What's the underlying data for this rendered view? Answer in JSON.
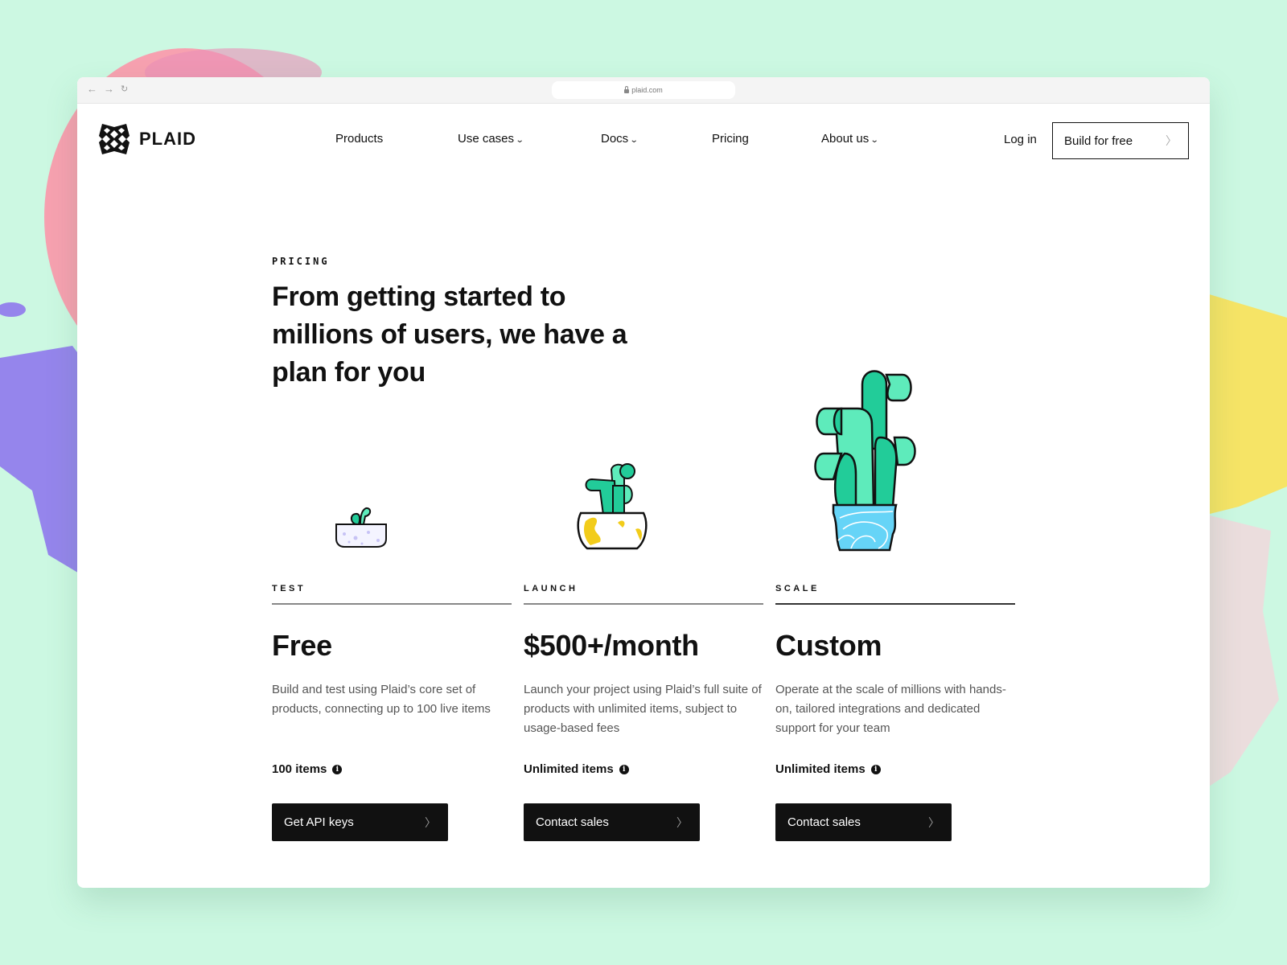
{
  "browser": {
    "url": "plaid.com",
    "back_icon": "←",
    "forward_icon": "→",
    "reload_icon": "↻"
  },
  "header": {
    "logo_text": "PLAID",
    "nav": [
      {
        "label": "Products",
        "has_dropdown": false
      },
      {
        "label": "Use cases",
        "has_dropdown": true
      },
      {
        "label": "Docs",
        "has_dropdown": true
      },
      {
        "label": "Pricing",
        "has_dropdown": false
      },
      {
        "label": "About us",
        "has_dropdown": true
      }
    ],
    "chevron_glyph": "⌄",
    "login_label": "Log in",
    "build_label": "Build for free",
    "arrow_glyph": "〉"
  },
  "hero": {
    "eyebrow": "PRICING",
    "headline": "From getting started to millions of users, we have a plan for you"
  },
  "plans": [
    {
      "tier": "TEST",
      "price": "Free",
      "description": "Build and test using Plaid’s core set of products, connecting up to 100 live items",
      "items": "100 items",
      "cta": "Get API keys"
    },
    {
      "tier": "LAUNCH",
      "price": "$500+/month",
      "description": "Launch your project using Plaid’s full suite of products with unlimited items, subject to usage-based fees",
      "items": "Unlimited items",
      "cta": "Contact sales"
    },
    {
      "tier": "SCALE",
      "price": "Custom",
      "description": "Operate at the scale of millions with hands-on, tailored integrations and dedicated support for your team",
      "items": "Unlimited items",
      "cta": "Contact sales"
    }
  ],
  "info_glyph": "i",
  "colors": {
    "background": "#ccf8e2",
    "plant_green": "#22cc99",
    "plant_light": "#5eebbb",
    "pot_yellow": "#f2cc1a",
    "pot_blue": "#66d4f7",
    "blob_pink": "#f7a1b0",
    "blob_purple": "#9585ec",
    "blob_yellow": "#f6e466"
  }
}
